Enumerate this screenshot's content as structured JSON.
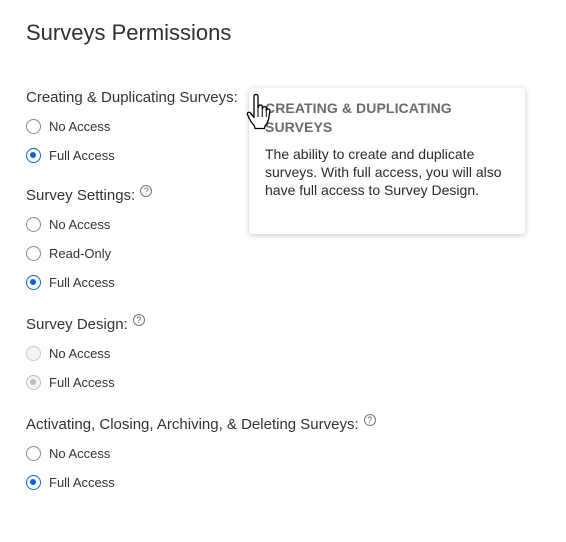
{
  "page": {
    "title": "Surveys Permissions"
  },
  "sections": [
    {
      "label": "Creating & Duplicating Surveys:",
      "has_help": false,
      "options": [
        {
          "label": "No Access"
        },
        {
          "label": "Full Access"
        }
      ],
      "selected": "Full Access",
      "disabled": false
    },
    {
      "label": "Survey Settings:",
      "has_help": true,
      "options": [
        {
          "label": "No Access"
        },
        {
          "label": "Read-Only"
        },
        {
          "label": "Full Access"
        }
      ],
      "selected": "Full Access",
      "disabled": false
    },
    {
      "label": "Survey Design:",
      "has_help": true,
      "options": [
        {
          "label": "No Access"
        },
        {
          "label": "Full Access"
        }
      ],
      "selected": "Full Access",
      "disabled": true
    },
    {
      "label": "Activating, Closing, Archiving, & Deleting Surveys:",
      "has_help": true,
      "options": [
        {
          "label": "No Access"
        },
        {
          "label": "Full Access"
        }
      ],
      "selected": "Full Access",
      "disabled": false
    }
  ],
  "help_glyph": "?",
  "tooltip": {
    "title": "Creating & Duplicating Surveys",
    "body": "The ability to create and duplicate surveys. With full access, you will also have full access to Survey Design."
  },
  "colors": {
    "accent": "#0a63d4",
    "disabled": "#bdbdbd"
  },
  "icons": {
    "cursor": "hand-pointer-icon",
    "help": "question-circle-icon"
  }
}
